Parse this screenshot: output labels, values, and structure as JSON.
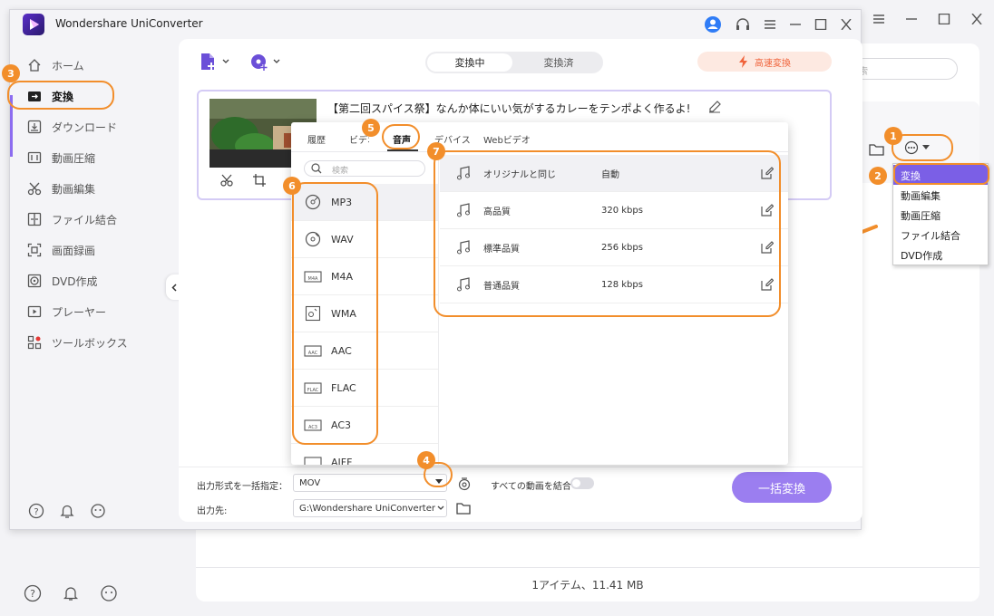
{
  "background_window": {
    "search_placeholder": "索",
    "footer_text": "1アイテム、11.41 MB"
  },
  "app": {
    "title": "Wondershare UniConverter"
  },
  "sidebar": {
    "items": [
      {
        "label": "ホーム"
      },
      {
        "label": "変換"
      },
      {
        "label": "ダウンロード"
      },
      {
        "label": "動画圧縮"
      },
      {
        "label": "動画編集"
      },
      {
        "label": "ファイル結合"
      },
      {
        "label": "画面録画"
      },
      {
        "label": "DVD作成"
      },
      {
        "label": "プレーヤー"
      },
      {
        "label": "ツールボックス"
      }
    ]
  },
  "top_tabs": {
    "converting": "変換中",
    "converted": "変換済"
  },
  "high_speed": "高速変換",
  "file": {
    "title": "【第二回スパイス祭】なんか体にいい気がするカレーをテンポよく作るよ!"
  },
  "format_popup": {
    "tabs": [
      "履歴",
      "ビデオ",
      "音声",
      "デバイス",
      "Webビデオ"
    ],
    "active_tab": "音声",
    "search_placeholder": "検索",
    "formats": [
      "MP3",
      "WAV",
      "M4A",
      "WMA",
      "AAC",
      "FLAC",
      "AC3",
      "AIFF"
    ],
    "qualities": [
      {
        "name": "オリジナルと同じ",
        "bitrate": "自動"
      },
      {
        "name": "高品質",
        "bitrate": "320 kbps"
      },
      {
        "name": "標準品質",
        "bitrate": "256 kbps"
      },
      {
        "name": "普通品質",
        "bitrate": "128 kbps"
      }
    ]
  },
  "bottom": {
    "output_format_label": "出力形式を一括指定：",
    "output_format_value": "MOV",
    "merge_label": "すべての動画を結合",
    "output_dest_label": "出力先:",
    "output_dest_value": "G:\\Wondershare UniConverter",
    "convert_all": "一括変換"
  },
  "context_menu": {
    "items": [
      "変換",
      "動画編集",
      "動画圧縮",
      "ファイル結合",
      "DVD作成"
    ]
  },
  "callouts": [
    "1",
    "2",
    "3",
    "4",
    "5",
    "6",
    "7"
  ],
  "colors": {
    "accent": "#8c6cf0",
    "callout": "#f28e2b",
    "highlight_bg": "#7b5fe6"
  }
}
